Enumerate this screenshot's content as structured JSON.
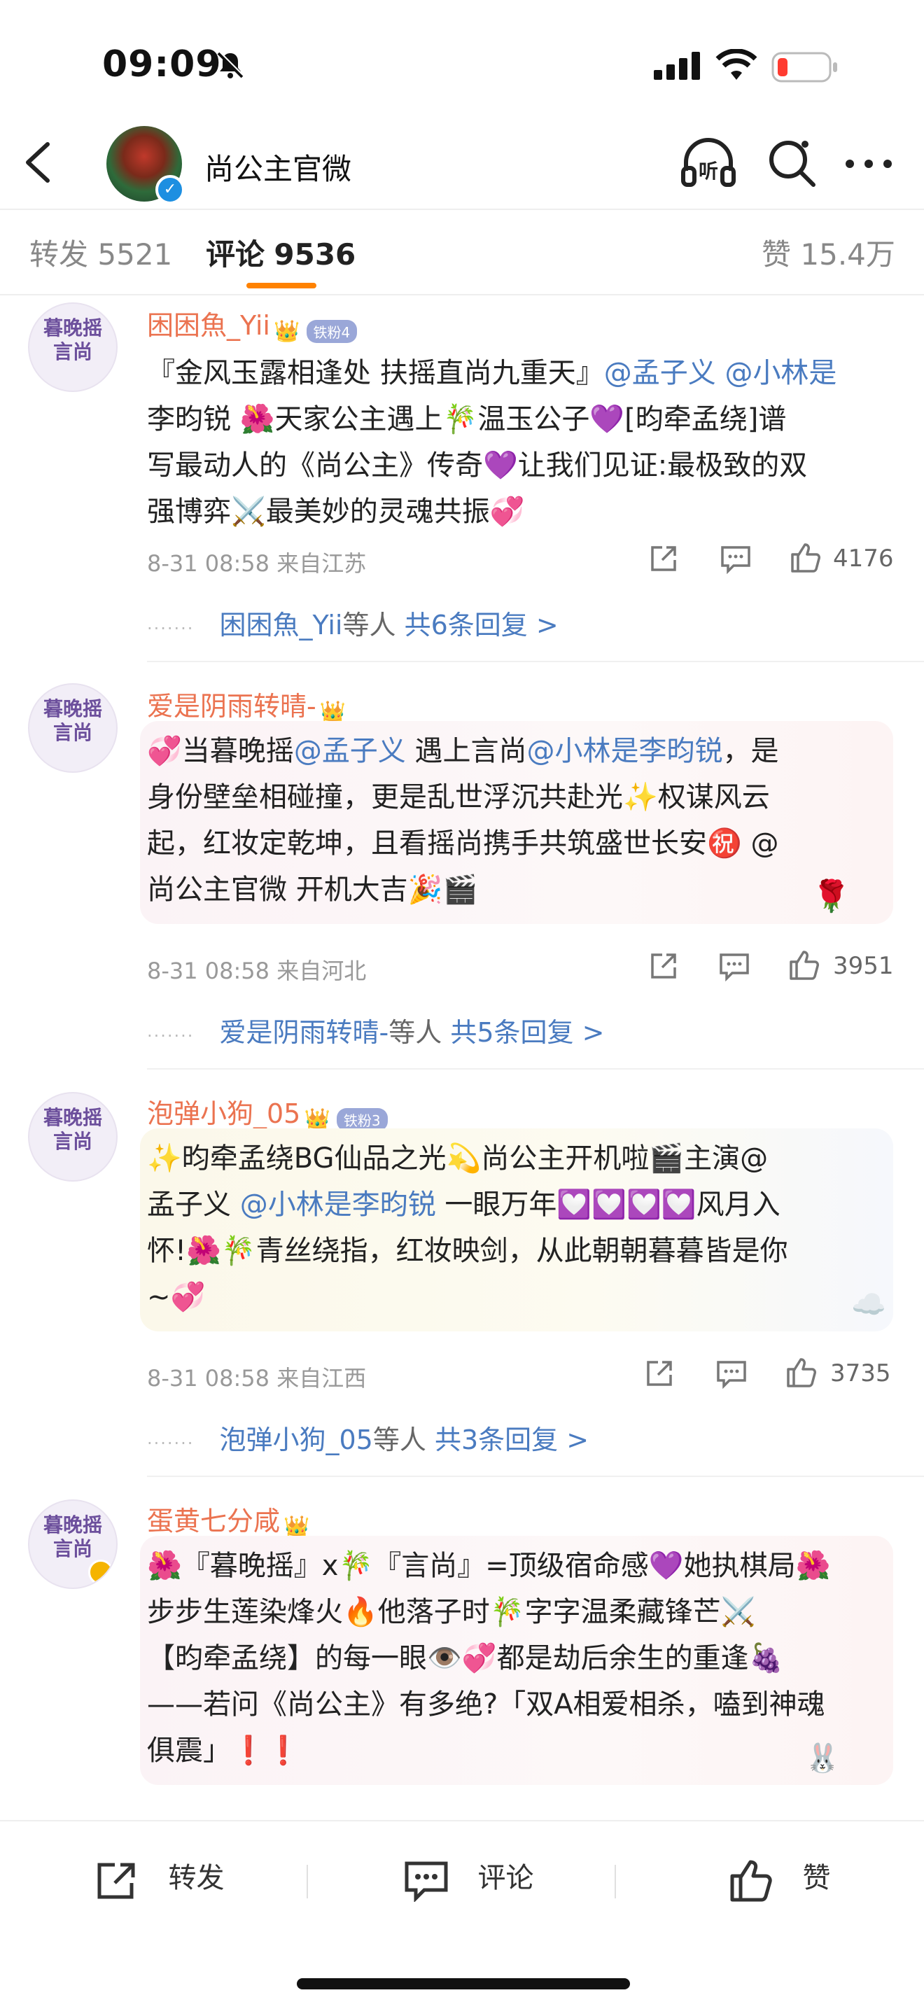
{
  "status_bar": {
    "time": "09:09"
  },
  "header": {
    "title": "尚公主官微"
  },
  "tabs": [
    {
      "label": "转发",
      "count": "5521"
    },
    {
      "label": "评论",
      "count": "9536"
    },
    {
      "label": "赞",
      "count": "15.4万"
    }
  ],
  "comments": [
    {
      "avatar_text": "暮晚摇\n言尚",
      "username": "困困魚_Yii",
      "crown": "👑",
      "fan_badge": "铁粉4",
      "lines": [
        "『金风玉露相逢处 扶摇直尚九重天』@孟子义 @小林是",
        "李昀锐 🌺天家公主遇上🎋温玉公子💜[昀牵孟绕]谱",
        "写最动人的《尚公主》传奇💜让我们见证:最极致的双",
        "强博弈⚔️最美妙的灵魂共振💞"
      ],
      "meta": "8-31 08:58  来自江苏",
      "likes": "4176",
      "reply_name": "困困魚_Yii",
      "reply_suffix": "等人",
      "reply_count": "共6条回复 >"
    },
    {
      "avatar_text": "暮晚摇\n言尚",
      "username": "爱是阴雨转晴-",
      "crown": "👑",
      "fan_badge": "",
      "lines": [
        "💞当暮晚摇@孟子义 遇上言尚@小林是李昀锐，是",
        "身份壁垒相碰撞，更是乱世浮沉共赴光✨权谋风云",
        "起，红妆定乾坤，且看摇尚携手共筑盛世长安㊗️ @",
        "尚公主官微  开机大吉🎉🎬"
      ],
      "meta": "8-31 08:58  来自河北",
      "likes": "3951",
      "reply_name": "爱是阴雨转晴-",
      "reply_suffix": "等人",
      "reply_count": "共5条回复 >"
    },
    {
      "avatar_text": "暮晚摇\n言尚",
      "username": "泡弹小狗_05",
      "crown": "👑",
      "fan_badge": "铁粉3",
      "lines": [
        "✨昀牵孟绕BG仙品之光💫尚公主开机啦🎬主演@",
        "孟子义 @小林是李昀锐  一眼万年💟💟💟💟风月入",
        "怀!🌺🎋青丝绕指，红妆映剑，从此朝朝暮暮皆是你",
        "~💞"
      ],
      "meta": "8-31 08:58  来自江西",
      "likes": "3735",
      "reply_name": "泡弹小狗_05",
      "reply_suffix": "等人",
      "reply_count": "共3条回复 >"
    },
    {
      "avatar_text": "暮晚摇\n言尚",
      "username": "蛋黄七分咸",
      "crown": "👑",
      "fan_badge": "",
      "lines": [
        "🌺『暮晚摇』x🎋『言尚』=顶级宿命感💜她执棋局🌺",
        "步步生莲染烽火🔥他落子时🎋字字温柔藏锋芒⚔️",
        "【昀牵孟绕】的每一眼👁️💞都是劫后余生的重逢🍇",
        "——若问《尚公主》有多绝?「双A相爱相杀，嗑到神魂",
        "俱震」❗❗"
      ]
    }
  ],
  "bottom_bar": {
    "repost": "转发",
    "comment": "评论",
    "like": "赞"
  },
  "icons": {
    "back": "back-chevron-icon",
    "listen": "headphones-icon",
    "search": "search-icon",
    "more": "more-dots-icon",
    "share": "share-icon",
    "comment": "comment-icon",
    "like": "thumbs-up-icon"
  },
  "colors": {
    "accent": "#ff8200",
    "username": "#eb7350",
    "link": "#4a7bc0"
  }
}
